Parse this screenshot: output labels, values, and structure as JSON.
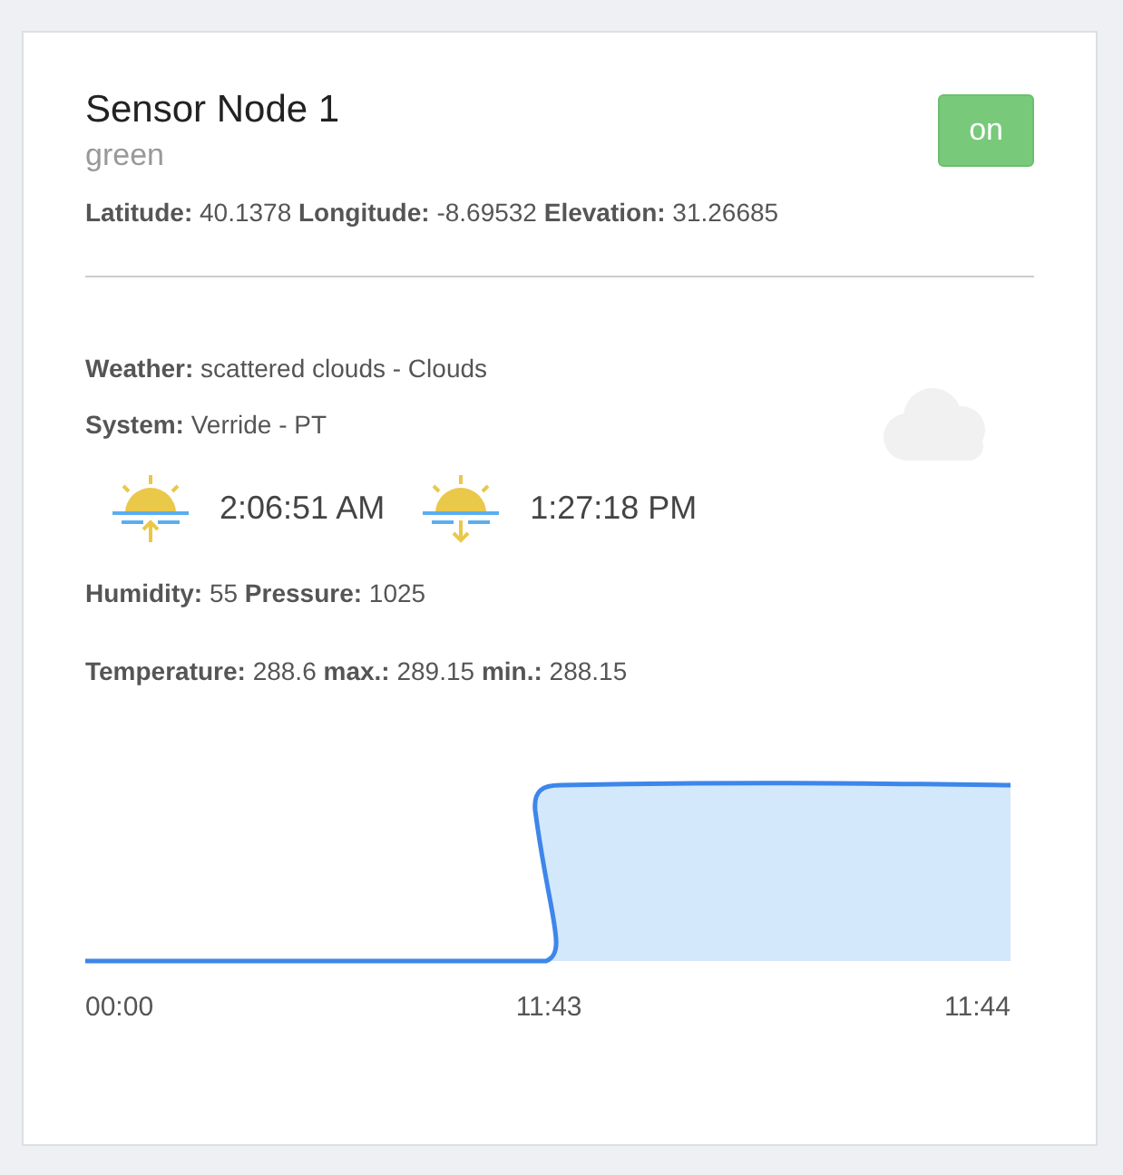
{
  "node": {
    "title": "Sensor Node 1",
    "subtitle": "green",
    "toggle": {
      "label": "on",
      "on": true
    },
    "location": "**Latitude:** 40.1378 **Longitude:** -8.69532 **Elevation:** 31.26685"
  },
  "weather": {
    "lines": [
      "**Weather:** scattered clouds - Clouds",
      "**System:** Verride - PT"
    ],
    "sun": [
      {
        "kind": "sunrise",
        "time": "2:06:51 AM"
      },
      {
        "kind": "sunset",
        "time": "1:27:18 PM"
      }
    ],
    "readings": [
      "**Humidity:** 55 **Pressure:** 1025",
      "**Temperature:** 288.6 **max.:** 289.15 **min.:** 288.15"
    ]
  },
  "chart": {
    "x_labels": [
      "00:00",
      "11:43",
      "11:44"
    ]
  }
}
